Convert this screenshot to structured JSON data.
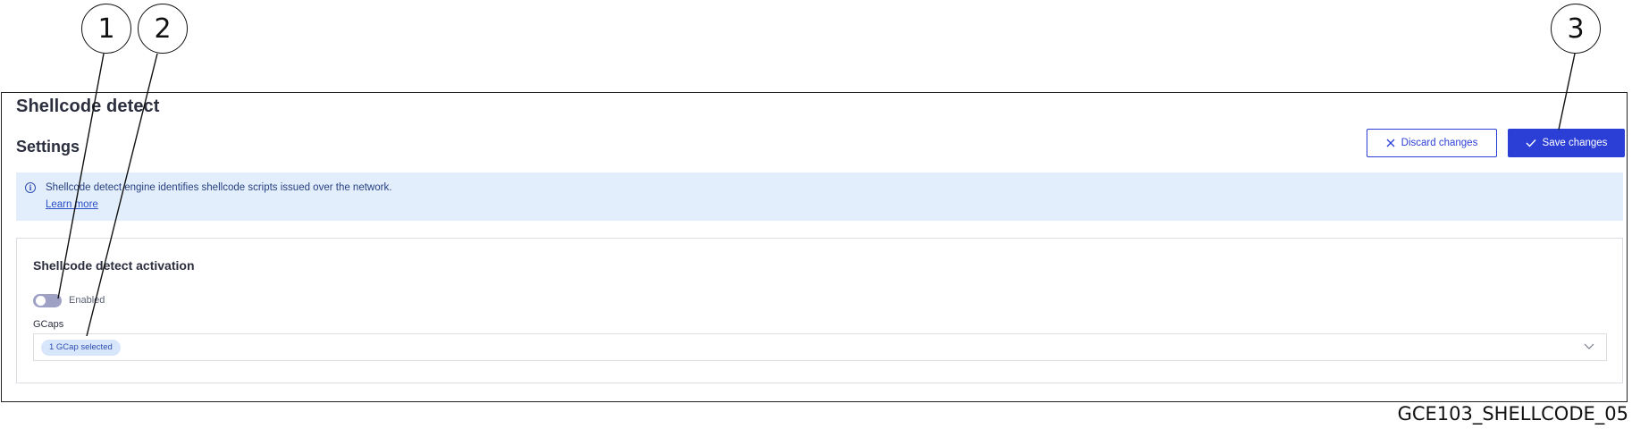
{
  "page": {
    "title": "Shellcode detect",
    "section_title": "Settings"
  },
  "toolbar": {
    "discard_label": "Discard changes",
    "save_label": "Save changes"
  },
  "info": {
    "text": "Shellcode detect engine identifies shellcode scripts issued over the network.",
    "link": "Learn more"
  },
  "activation": {
    "title": "Shellcode detect activation",
    "toggle_label": "Enabled",
    "toggle_state": "off"
  },
  "gcaps": {
    "label": "GCaps",
    "selected_chip": "1 GCap selected"
  },
  "callouts": [
    "1",
    "2",
    "3"
  ],
  "figure_id": "GCE103_SHELLCODE_05",
  "colors": {
    "accent": "#2b3fd6",
    "info_bg": "#e3eefc",
    "chip_bg": "#d8e6fb",
    "toggle_off": "#9ea1c3"
  }
}
